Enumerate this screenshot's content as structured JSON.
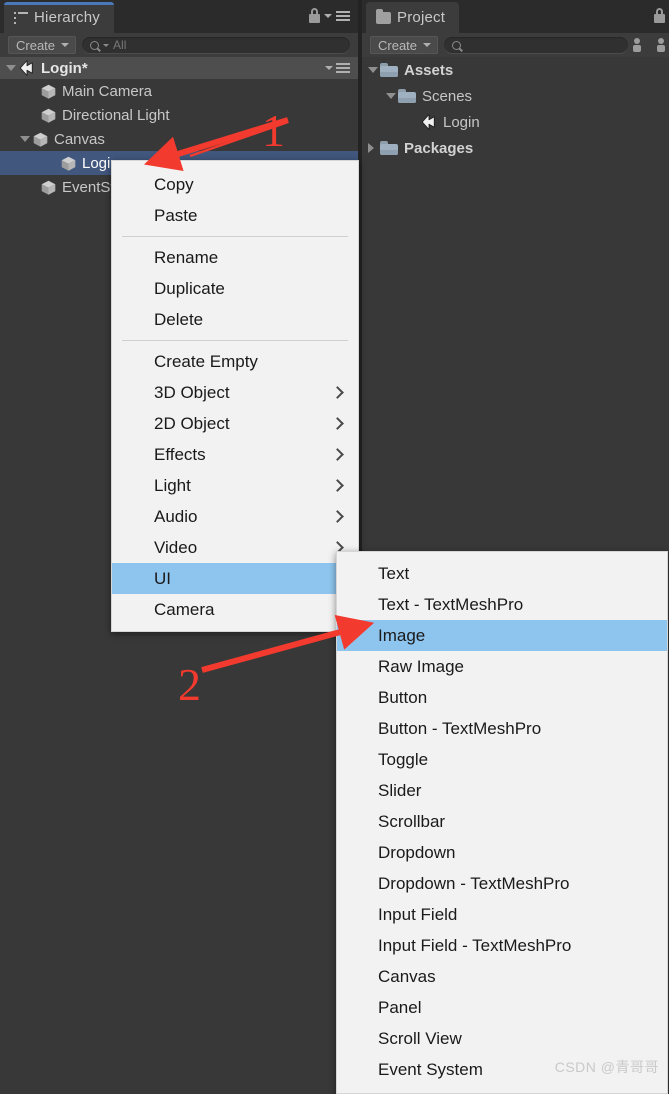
{
  "theme": {
    "bg": "#383838",
    "panel_bg": "#3c3c3c",
    "tab_bar": "#2b2b2b",
    "accent_tab": "#4a78b8",
    "selection_blue": "#41577d",
    "menu_bg": "#f2f2f2",
    "menu_highlight": "#8ec5ef",
    "annotation_red": "#f23a2e"
  },
  "hierarchy": {
    "tab_label": "Hierarchy",
    "tab_icon": "hierarchy-icon",
    "create_label": "Create",
    "search_placeholder": "All",
    "search_value": "All",
    "lock_icon": "lock-icon",
    "menu_icon": "hamburger-menu-icon",
    "scene": {
      "name": "Login*",
      "icon": "unity-scene-icon",
      "expanded": true
    },
    "items": [
      {
        "label": "Main Camera",
        "icon": "cube-icon",
        "depth": 1,
        "toggle": "none",
        "selected": false
      },
      {
        "label": "Directional Light",
        "icon": "cube-icon",
        "depth": 1,
        "toggle": "none",
        "selected": false
      },
      {
        "label": "Canvas",
        "icon": "cube-icon",
        "depth": 1,
        "toggle": "expanded",
        "selected": false
      },
      {
        "label": "Login",
        "icon": "cube-icon",
        "depth": 2,
        "toggle": "none",
        "selected": true
      },
      {
        "label": "EventSystem",
        "icon": "cube-icon",
        "depth": 1,
        "toggle": "none",
        "selected": false
      }
    ]
  },
  "project": {
    "tab_label": "Project",
    "tab_icon": "folder-icon",
    "create_label": "Create",
    "search_placeholder": "",
    "search_value": "",
    "account_icon": "person-icon",
    "lock_icon": "lock-icon",
    "items": [
      {
        "label": "Assets",
        "icon": "folder-icon",
        "depth": 0,
        "toggle": "expanded",
        "bold": true
      },
      {
        "label": "Scenes",
        "icon": "folder-icon",
        "depth": 1,
        "toggle": "expanded",
        "bold": false
      },
      {
        "label": "Login",
        "icon": "unity-scene-icon",
        "depth": 2,
        "toggle": "none",
        "bold": false
      },
      {
        "label": "Packages",
        "icon": "folder-icon",
        "depth": 0,
        "toggle": "collapsed",
        "bold": true
      }
    ]
  },
  "context_menu": {
    "items": [
      {
        "label": "Copy",
        "type": "item",
        "submenu": false,
        "highlight": false
      },
      {
        "label": "Paste",
        "type": "item",
        "submenu": false,
        "highlight": false
      },
      {
        "label": "",
        "type": "separator",
        "submenu": false,
        "highlight": false
      },
      {
        "label": "Rename",
        "type": "item",
        "submenu": false,
        "highlight": false
      },
      {
        "label": "Duplicate",
        "type": "item",
        "submenu": false,
        "highlight": false
      },
      {
        "label": "Delete",
        "type": "item",
        "submenu": false,
        "highlight": false
      },
      {
        "label": "",
        "type": "separator",
        "submenu": false,
        "highlight": false
      },
      {
        "label": "Create Empty",
        "type": "item",
        "submenu": false,
        "highlight": false
      },
      {
        "label": "3D Object",
        "type": "item",
        "submenu": true,
        "highlight": false
      },
      {
        "label": "2D Object",
        "type": "item",
        "submenu": true,
        "highlight": false
      },
      {
        "label": "Effects",
        "type": "item",
        "submenu": true,
        "highlight": false
      },
      {
        "label": "Light",
        "type": "item",
        "submenu": true,
        "highlight": false
      },
      {
        "label": "Audio",
        "type": "item",
        "submenu": true,
        "highlight": false
      },
      {
        "label": "Video",
        "type": "item",
        "submenu": true,
        "highlight": false
      },
      {
        "label": "UI",
        "type": "item",
        "submenu": true,
        "highlight": true
      },
      {
        "label": "Camera",
        "type": "item",
        "submenu": false,
        "highlight": false
      }
    ]
  },
  "ui_submenu": {
    "items": [
      {
        "label": "Text",
        "highlight": false
      },
      {
        "label": "Text - TextMeshPro",
        "highlight": false
      },
      {
        "label": "Image",
        "highlight": true
      },
      {
        "label": "Raw Image",
        "highlight": false
      },
      {
        "label": "Button",
        "highlight": false
      },
      {
        "label": "Button - TextMeshPro",
        "highlight": false
      },
      {
        "label": "Toggle",
        "highlight": false
      },
      {
        "label": "Slider",
        "highlight": false
      },
      {
        "label": "Scrollbar",
        "highlight": false
      },
      {
        "label": "Dropdown",
        "highlight": false
      },
      {
        "label": "Dropdown - TextMeshPro",
        "highlight": false
      },
      {
        "label": "Input Field",
        "highlight": false
      },
      {
        "label": "Input Field - TextMeshPro",
        "highlight": false
      },
      {
        "label": "Canvas",
        "highlight": false
      },
      {
        "label": "Panel",
        "highlight": false
      },
      {
        "label": "Scroll View",
        "highlight": false
      },
      {
        "label": "Event System",
        "highlight": false
      }
    ]
  },
  "annotations": [
    {
      "label": "1",
      "points_to": "Login object row in Hierarchy"
    },
    {
      "label": "2",
      "points_to": "Image item in UI submenu"
    }
  ],
  "watermark": {
    "text": "CSDN @青哥哥"
  }
}
